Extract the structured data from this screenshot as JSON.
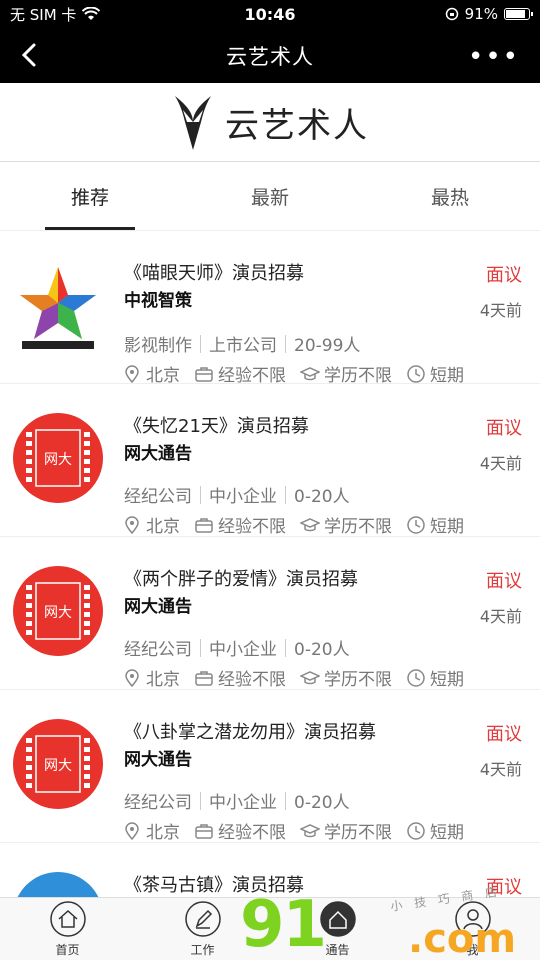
{
  "status": {
    "carrier": "无 SIM 卡",
    "time": "10:46",
    "battery": "91%",
    "battery_level": 0.91
  },
  "nav": {
    "title": "云艺术人"
  },
  "logo": {
    "text": "云艺术人"
  },
  "tabs": [
    {
      "label": "推荐"
    },
    {
      "label": "最新"
    },
    {
      "label": "最热"
    }
  ],
  "jobs": [
    {
      "title": "《喵眼天师》演员招募",
      "company": "中视智策",
      "salary": "面议",
      "time": "4天前",
      "industry": "影视制作",
      "type": "上市公司",
      "size": "20-99人",
      "city": "北京",
      "experience": "经验不限",
      "education": "学历不限",
      "duration": "短期",
      "avatar": "star-logo"
    },
    {
      "title": "《失忆21天》演员招募",
      "company": "网大通告",
      "salary": "面议",
      "time": "4天前",
      "industry": "经纪公司",
      "type": "中小企业",
      "size": "0-20人",
      "city": "北京",
      "experience": "经验不限",
      "education": "学历不限",
      "duration": "短期",
      "avatar": "film-logo",
      "avatar_text": "网大"
    },
    {
      "title": "《两个胖子的爱情》演员招募",
      "company": "网大通告",
      "salary": "面议",
      "time": "4天前",
      "industry": "经纪公司",
      "type": "中小企业",
      "size": "0-20人",
      "city": "北京",
      "experience": "经验不限",
      "education": "学历不限",
      "duration": "短期",
      "avatar": "film-logo",
      "avatar_text": "网大"
    },
    {
      "title": "《八卦掌之潜龙勿用》演员招募",
      "company": "网大通告",
      "salary": "面议",
      "time": "4天前",
      "industry": "经纪公司",
      "type": "中小企业",
      "size": "0-20人",
      "city": "北京",
      "experience": "经验不限",
      "education": "学历不限",
      "duration": "短期",
      "avatar": "film-logo",
      "avatar_text": "网大"
    },
    {
      "title": "《茶马古镇》演员招募",
      "company": "",
      "salary": "面议",
      "time": "",
      "industry": "",
      "type": "",
      "size": "",
      "city": "",
      "experience": "",
      "education": "",
      "duration": "",
      "avatar": "blue-logo"
    }
  ],
  "tabbar": [
    {
      "label": "首页",
      "icon": "home-icon"
    },
    {
      "label": "工作",
      "icon": "edit-icon"
    },
    {
      "label": "通告",
      "icon": "notice-icon"
    },
    {
      "label": "我",
      "icon": "user-icon"
    }
  ],
  "watermark": {
    "main": "91",
    "suffix": ".com",
    "small": "小 技 巧 商 店"
  },
  "colors": {
    "salary": "#e03a3a",
    "film_red": "#e8322c",
    "bar": "#000000"
  }
}
